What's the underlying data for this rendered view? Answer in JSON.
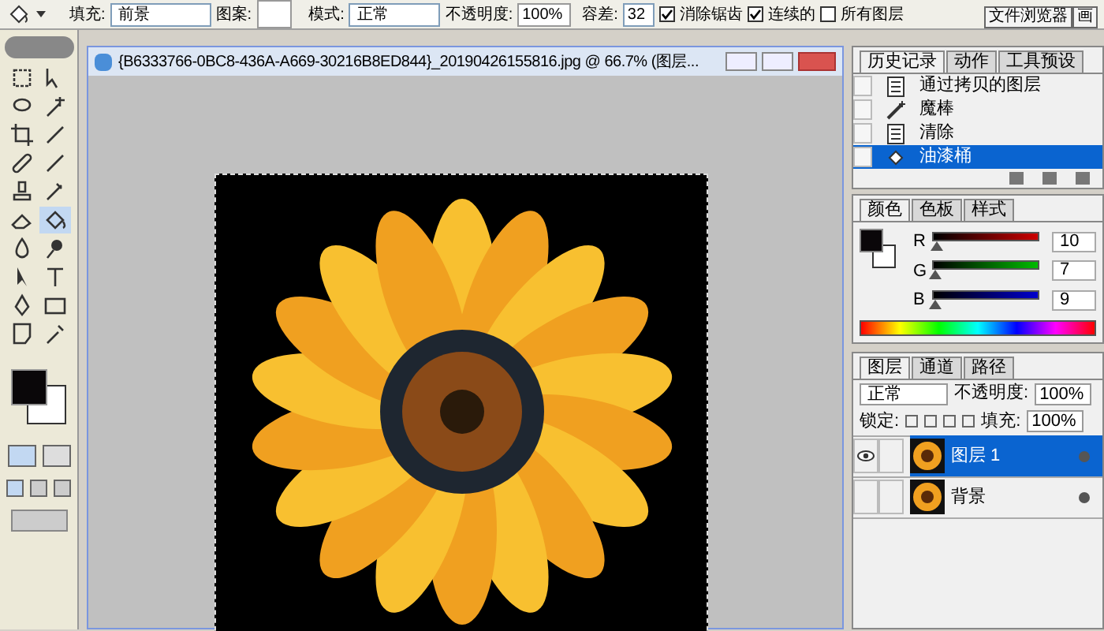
{
  "options_bar": {
    "fill_label": "填充:",
    "fill_value": "前景",
    "pattern_label": "图案:",
    "mode_label": "模式:",
    "mode_value": "正常",
    "opacity_label": "不透明度:",
    "opacity_value": "100%",
    "tolerance_label": "容差:",
    "tolerance_value": "32",
    "checkboxes": [
      {
        "label": "消除锯齿",
        "checked": true
      },
      {
        "label": "连续的",
        "checked": true
      },
      {
        "label": "所有图层",
        "checked": false
      }
    ],
    "palette_tabs": [
      "文件浏览器",
      "画"
    ]
  },
  "toolbox": {
    "tools": [
      {
        "selected": false
      },
      {
        "selected": false
      },
      {
        "selected": false
      },
      {
        "selected": false
      },
      {
        "selected": false
      },
      {
        "selected": false
      },
      {
        "selected": false
      },
      {
        "selected": false
      },
      {
        "selected": false
      },
      {
        "selected": false
      },
      {
        "selected": false
      },
      {
        "selected": true
      },
      {
        "selected": false
      },
      {
        "selected": false
      },
      {
        "selected": false
      },
      {
        "selected": false
      },
      {
        "selected": false
      },
      {
        "selected": false
      },
      {
        "selected": false
      },
      {
        "selected": false
      }
    ]
  },
  "document": {
    "title": "{B6333766-0BC8-436A-A669-30216B8ED844}_20190426155816.jpg @ 66.7% (图层..."
  },
  "history_panel": {
    "tabs": [
      {
        "label": "历史记录",
        "selected": true
      },
      {
        "label": "动作",
        "selected": false
      },
      {
        "label": "工具预设",
        "selected": false
      }
    ],
    "items": [
      {
        "label": "通过拷贝的图层",
        "kind": "layer",
        "selected": false
      },
      {
        "label": "魔棒",
        "kind": "wand",
        "selected": false
      },
      {
        "label": "清除",
        "kind": "layer",
        "selected": false
      },
      {
        "label": "油漆桶",
        "kind": "bucket",
        "selected": true
      }
    ]
  },
  "color_panel": {
    "tabs": [
      {
        "label": "颜色",
        "selected": true
      },
      {
        "label": "色板",
        "selected": false
      },
      {
        "label": "样式",
        "selected": false
      }
    ],
    "channels": [
      {
        "name": "R",
        "value": "10",
        "level": 0.04
      },
      {
        "name": "G",
        "value": "7",
        "level": 0.03
      },
      {
        "name": "B",
        "value": "9",
        "level": 0.035
      }
    ]
  },
  "layers_panel": {
    "tabs": [
      {
        "label": "图层",
        "selected": true
      },
      {
        "label": "通道",
        "selected": false
      },
      {
        "label": "路径",
        "selected": false
      }
    ],
    "blend_mode": "正常",
    "opacity_label": "不透明度:",
    "opacity_value": "100%",
    "lock_label": "锁定:",
    "fill_label": "填充:",
    "fill_value": "100%",
    "layers": [
      {
        "name": "图层 1",
        "visible": true,
        "selected": true
      },
      {
        "name": "背景",
        "visible": false,
        "selected": false
      }
    ]
  }
}
